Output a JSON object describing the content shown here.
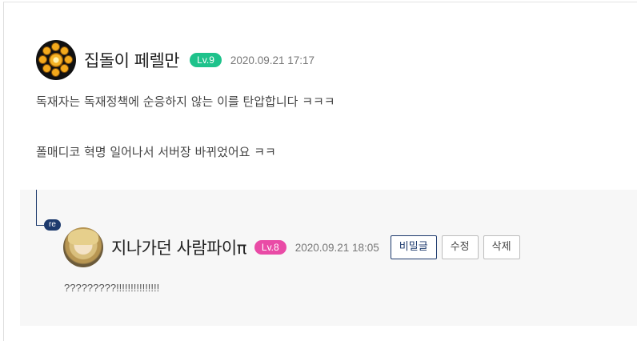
{
  "comment": {
    "nickname": "집돌이 페렐만",
    "level": "Lv.9",
    "date": "2020.09.21 17:17",
    "lines": [
      "독재자는 독재정책에 순응하지 않는 이를 탄압합니다 ㅋㅋㅋ",
      "폴매디코 혁명 일어나서 서버장 바뀌었어요 ㅋㅋ"
    ],
    "level_color": "#1ec28b"
  },
  "reply": {
    "badge": "re",
    "nickname": "지나가던 사람파이π",
    "level": "Lv.8",
    "date": "2020.09.21 18:05",
    "buttons": {
      "secret": "비밀글",
      "edit": "수정",
      "delete": "삭제"
    },
    "text": "?????????!!!!!!!!!!!!!!!",
    "level_color": "#e94ba6"
  }
}
